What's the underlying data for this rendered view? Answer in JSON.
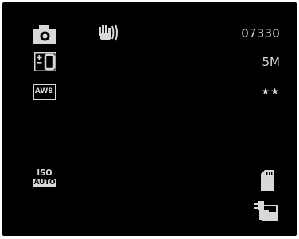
{
  "status": {
    "shot_counter": "07330",
    "resolution": "5M",
    "quality": "★★"
  },
  "iso": {
    "label": "ISO",
    "value": "AUTO"
  },
  "icons": {
    "mode": "camera-icon",
    "stabilizer": "hand-shake-icon",
    "exposure": "exposure-compensation-icon",
    "white_balance": "awb-icon",
    "white_balance_label": "AWB",
    "storage": "sd-card-icon",
    "print": "print-transfer-icon"
  },
  "colors": {
    "lcd_background": "#000000",
    "icon": "#d8d8d8"
  }
}
